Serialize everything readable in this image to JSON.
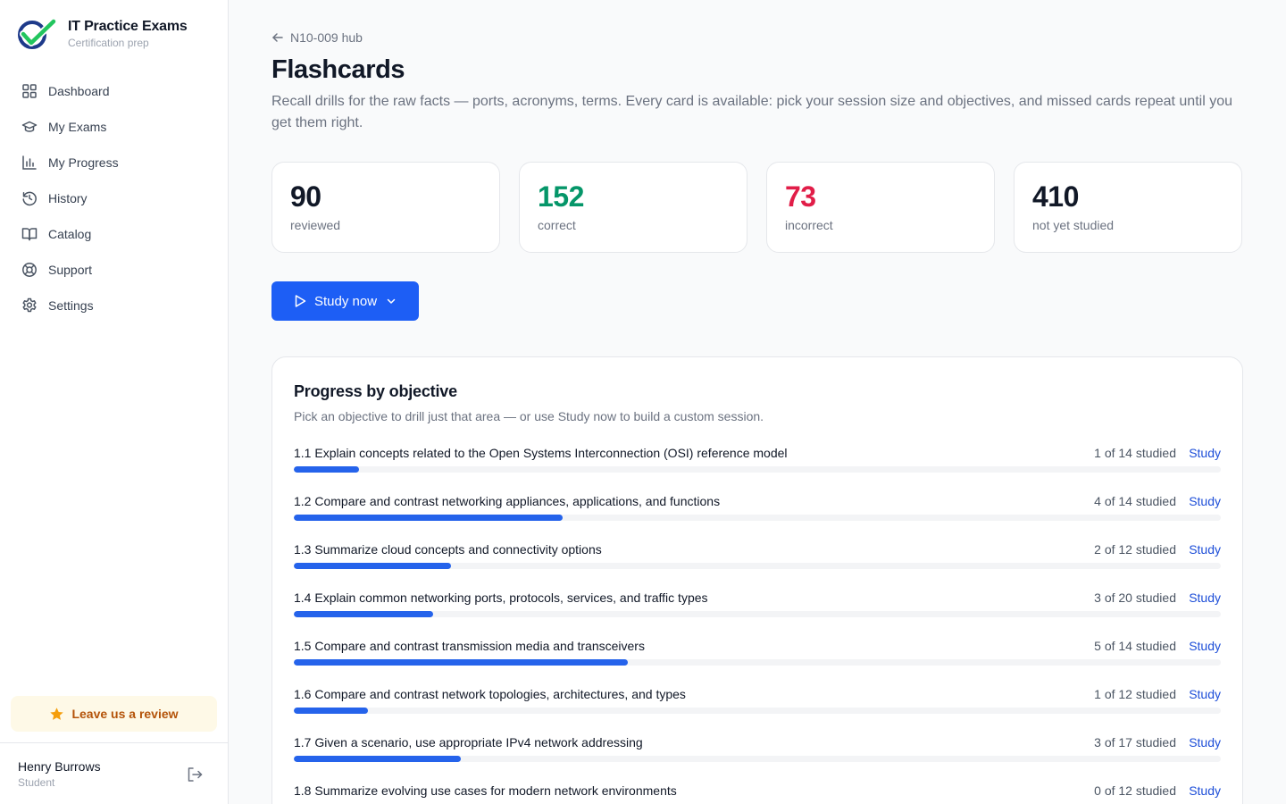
{
  "brand": {
    "name": "IT Practice Exams",
    "subtitle": "Certification prep"
  },
  "nav": [
    {
      "id": "dashboard",
      "label": "Dashboard",
      "icon": "grid-icon"
    },
    {
      "id": "my-exams",
      "label": "My Exams",
      "icon": "graduation-cap-icon"
    },
    {
      "id": "my-progress",
      "label": "My Progress",
      "icon": "bar-chart-icon"
    },
    {
      "id": "history",
      "label": "History",
      "icon": "history-icon"
    },
    {
      "id": "catalog",
      "label": "Catalog",
      "icon": "book-open-icon"
    },
    {
      "id": "support",
      "label": "Support",
      "icon": "life-buoy-icon"
    },
    {
      "id": "settings",
      "label": "Settings",
      "icon": "gear-icon"
    }
  ],
  "review": {
    "label": "Leave us a review"
  },
  "user": {
    "name": "Henry Burrows",
    "role": "Student"
  },
  "main": {
    "back_label": "N10-009 hub",
    "title": "Flashcards",
    "description": "Recall drills for the raw facts — ports, acronyms, terms. Every card is available: pick your session size and objectives, and missed cards repeat until you get them right.",
    "stats": [
      {
        "value": "90",
        "label": "reviewed",
        "color": "#111827"
      },
      {
        "value": "152",
        "label": "correct",
        "color": "#059669"
      },
      {
        "value": "73",
        "label": "incorrect",
        "color": "#e11d48"
      },
      {
        "value": "410",
        "label": "not yet studied",
        "color": "#111827"
      }
    ],
    "study_button": "Study now"
  },
  "panel": {
    "title": "Progress by objective",
    "subtitle": "Pick an objective to drill just that area — or use Study now to build a custom session.",
    "study_label": "Study",
    "objectives": [
      {
        "name": "1.1 Explain concepts related to the Open Systems Interconnection (OSI) reference model",
        "count": "1 of 14 studied",
        "studied": 1,
        "total": 14,
        "progress": 0.07
      },
      {
        "name": "1.2 Compare and contrast networking appliances, applications, and functions",
        "count": "4 of 14 studied",
        "studied": 4,
        "total": 14,
        "progress": 0.29
      },
      {
        "name": "1.3 Summarize cloud concepts and connectivity options",
        "count": "2 of 12 studied",
        "studied": 2,
        "total": 12,
        "progress": 0.17
      },
      {
        "name": "1.4 Explain common networking ports, protocols, services, and traffic types",
        "count": "3 of 20 studied",
        "studied": 3,
        "total": 20,
        "progress": 0.15
      },
      {
        "name": "1.5 Compare and contrast transmission media and transceivers",
        "count": "5 of 14 studied",
        "studied": 5,
        "total": 14,
        "progress": 0.36
      },
      {
        "name": "1.6 Compare and contrast network topologies, architectures, and types",
        "count": "1 of 12 studied",
        "studied": 1,
        "total": 12,
        "progress": 0.08
      },
      {
        "name": "1.7 Given a scenario, use appropriate IPv4 network addressing",
        "count": "3 of 17 studied",
        "studied": 3,
        "total": 17,
        "progress": 0.18
      },
      {
        "name": "1.8 Summarize evolving use cases for modern network environments",
        "count": "0 of 12 studied",
        "studied": 0,
        "total": 12,
        "progress": 0
      }
    ]
  }
}
